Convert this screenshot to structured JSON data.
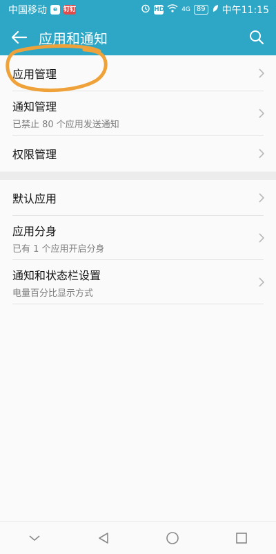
{
  "status": {
    "carrier": "中国移动",
    "badge1": "e",
    "badge2": "钉钉",
    "hd": "HD",
    "network": "4G",
    "battery": "89",
    "time": "中午11:15"
  },
  "header": {
    "title": "应用和通知"
  },
  "groups": [
    {
      "items": [
        {
          "primary": "应用管理",
          "secondary": ""
        },
        {
          "primary": "通知管理",
          "secondary": "已禁止 80 个应用发送通知"
        },
        {
          "primary": "权限管理",
          "secondary": ""
        }
      ]
    },
    {
      "items": [
        {
          "primary": "默认应用",
          "secondary": ""
        },
        {
          "primary": "应用分身",
          "secondary": "已有 1 个应用开启分身"
        },
        {
          "primary": "通知和状态栏设置",
          "secondary": "电量百分比显示方式"
        }
      ]
    }
  ],
  "colors": {
    "accent": "#2ea7c6",
    "annotation": "#f0a23a"
  }
}
